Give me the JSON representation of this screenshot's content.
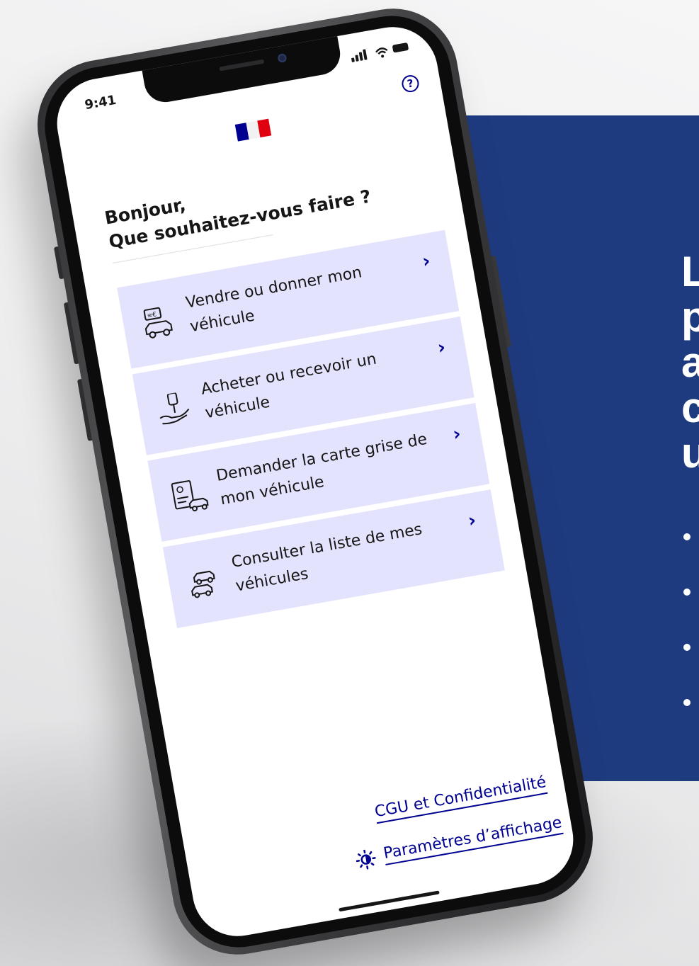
{
  "panel": {
    "headline_fragment": "L\np\na\nc\nu",
    "bullet_count": 4,
    "color": "#1f3b80"
  },
  "status_bar": {
    "time": "9:41"
  },
  "header": {
    "help_icon": "question-circle-icon",
    "help_glyph": "?",
    "flag_colors": [
      "#000091",
      "#ffffff",
      "#e1000f"
    ]
  },
  "greeting": {
    "line1": "Bonjour,",
    "line2": "Que souhaitez-vous faire ?"
  },
  "menu": [
    {
      "label": "Vendre ou donner mon véhicule",
      "icon": "sell-car-icon"
    },
    {
      "label": "Acheter ou recevoir un véhicule",
      "icon": "key-hand-icon"
    },
    {
      "label": "Demander la carte grise de mon véhicule",
      "icon": "registration-card-icon"
    },
    {
      "label": "Consulter la liste de mes véhicules",
      "icon": "car-list-icon"
    }
  ],
  "chevron": "›",
  "footer": {
    "cgu_link": "CGU et Confidentialité",
    "display_settings_link": "Paramètres d’affichage",
    "display_settings_icon": "brightness-icon"
  },
  "colors": {
    "accent": "#000091",
    "card_bg": "#e3e3fd",
    "text": "#161616"
  }
}
